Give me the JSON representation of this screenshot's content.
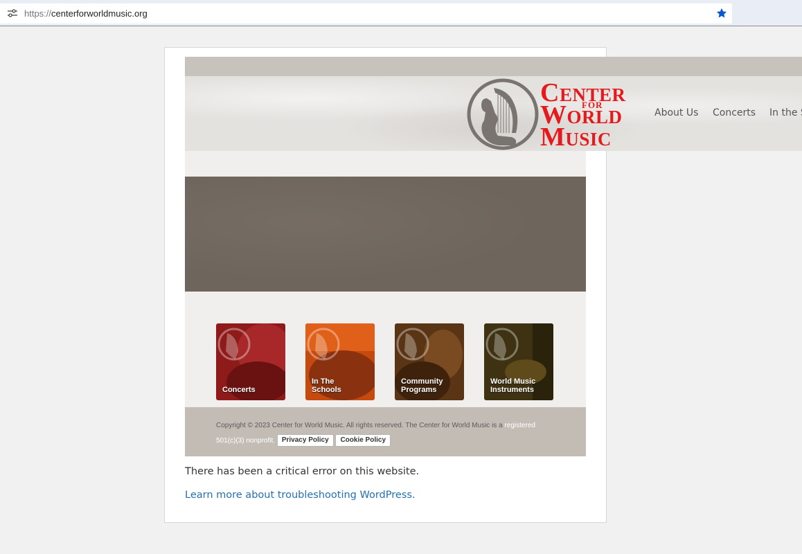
{
  "browser": {
    "url_scheme": "https://",
    "url_host": "centerforworldmusic.org",
    "icons": {
      "site_info": "tune-icon",
      "bookmark": "star-icon"
    },
    "accent_color": "#0b57d0"
  },
  "site": {
    "logo": {
      "line1": "Center",
      "for": "FOR",
      "line2": "World",
      "line3": "Music",
      "color": "#e41a1c",
      "icon": "harpist-logo-icon"
    },
    "nav": {
      "items": [
        "About Us",
        "Concerts",
        "In the S"
      ]
    },
    "tiles": [
      {
        "line1": "Concerts",
        "line2": "",
        "color": "#8e1a1a"
      },
      {
        "line1": "In The",
        "line2": "Schools",
        "color": "#c44a10"
      },
      {
        "line1": "Community",
        "line2": "Programs",
        "color": "#5a3515"
      },
      {
        "line1": "World Music",
        "line2": "Instruments",
        "color": "#3e3212"
      }
    ],
    "footer": {
      "copyright": "Copyright © 2023 Center for World Music. All rights reserved. The Center for World Music is a",
      "registered": "registered",
      "nonprofit": "501(c)(3) nonprofit.",
      "privacy_button": "Privacy Policy",
      "cookie_button": "Cookie Policy"
    }
  },
  "error": {
    "message": "There has been a critical error on this website.",
    "link": "Learn more about troubleshooting WordPress.",
    "link_color": "#2271b1"
  }
}
